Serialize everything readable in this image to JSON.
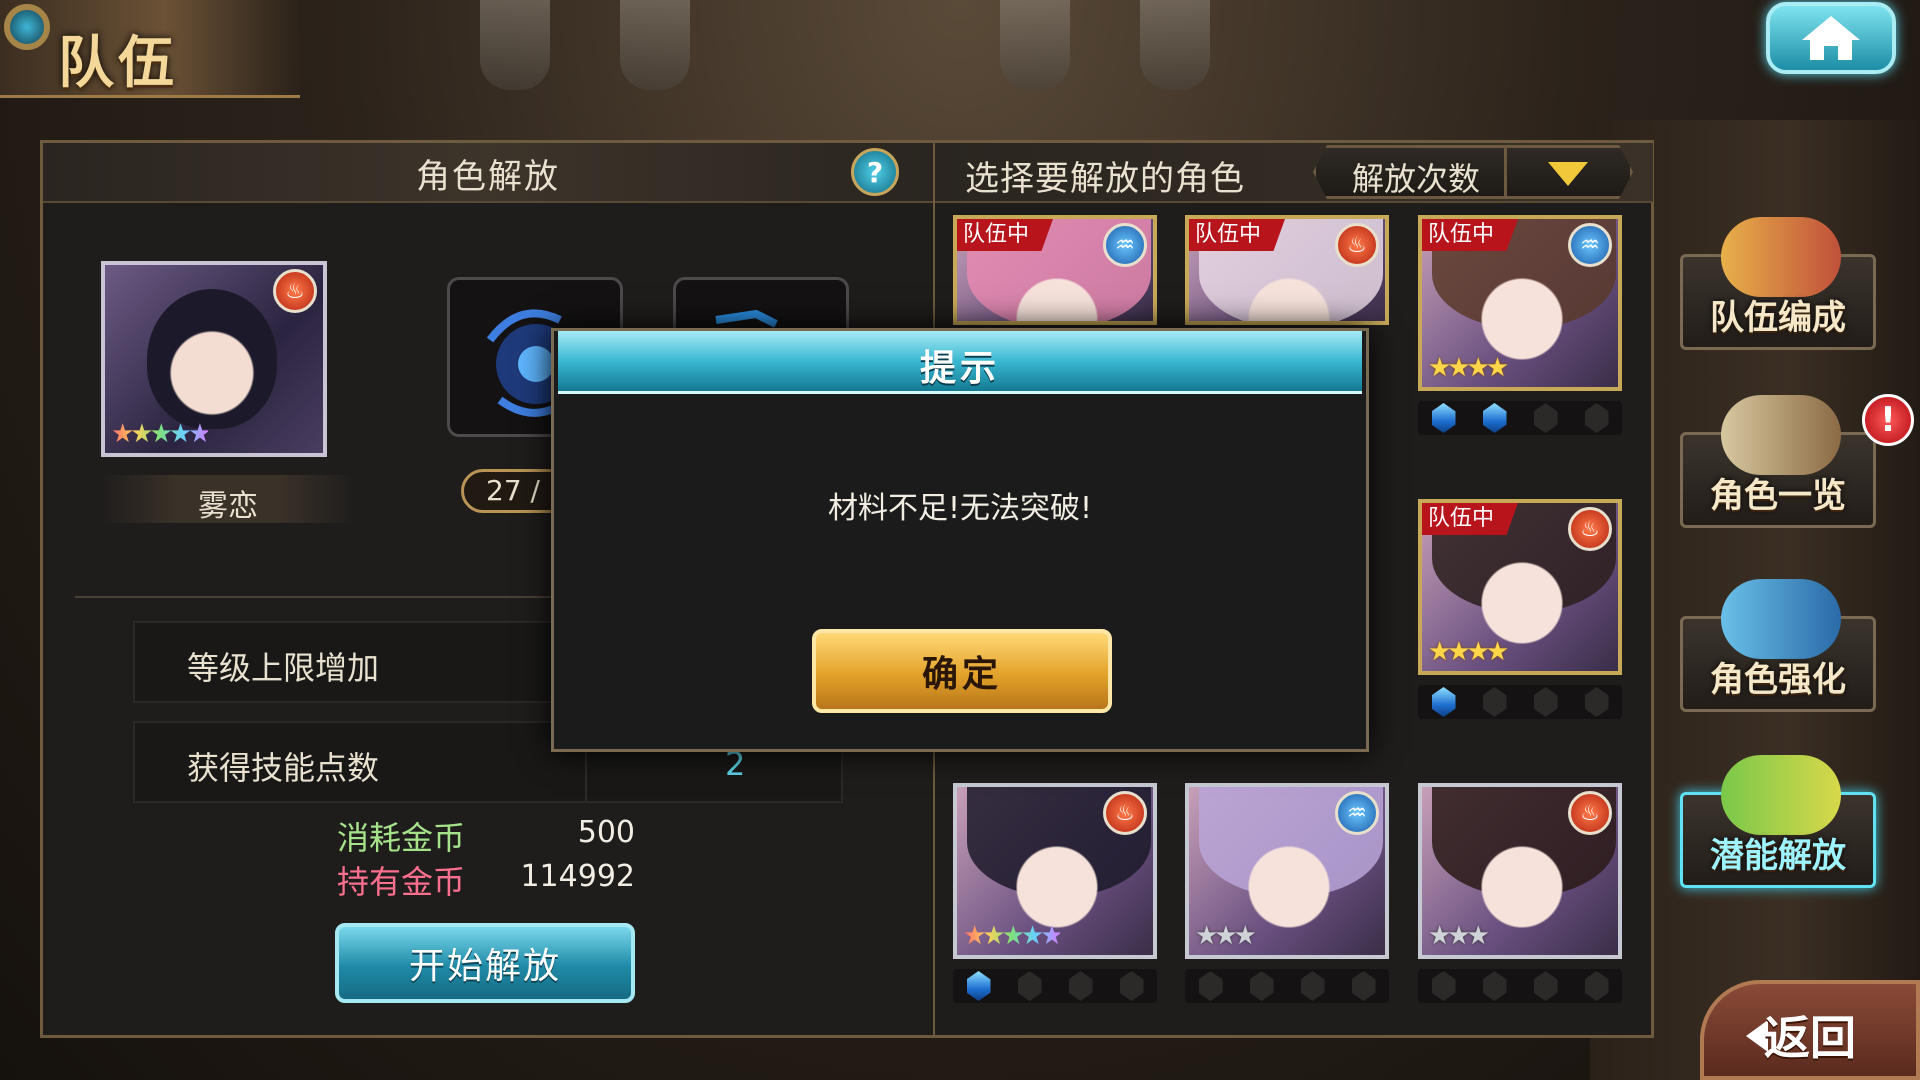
{
  "header": {
    "title": "队伍"
  },
  "left_panel": {
    "title": "角色解放",
    "help_label": "?",
    "character": {
      "name": "雾恋",
      "stars": "★★★★★"
    },
    "material_count": "27 /",
    "stats": [
      {
        "label": "等级上限增加",
        "value": ""
      },
      {
        "label": "获得技能点数",
        "value": "2"
      }
    ],
    "gold": {
      "cost_label": "消耗金币",
      "cost_value": "500",
      "have_label": "持有金币",
      "have_value": "114992"
    },
    "start_button": "开始解放"
  },
  "right_panel": {
    "title": "选择要解放的角色",
    "sort_label": "解放次数",
    "in_team_label": "队伍中",
    "cards": [
      {
        "in_team": true,
        "element": "water",
        "stars": "",
        "gems": []
      },
      {
        "in_team": true,
        "element": "fire",
        "stars": "",
        "gems": []
      },
      {
        "in_team": true,
        "element": "water",
        "stars": "★★★★",
        "gems": [
          1,
          1,
          0,
          0
        ]
      },
      {
        "in_team": true,
        "element": "fire",
        "stars": "★★★★",
        "gems": [
          1,
          0,
          0,
          0
        ]
      },
      {
        "in_team": false,
        "element": "fire",
        "stars": "★★★★★",
        "gems": [
          1,
          0,
          0,
          0
        ]
      },
      {
        "in_team": false,
        "element": "water",
        "stars": "★★★",
        "gems": [
          0,
          0,
          0,
          0
        ]
      },
      {
        "in_team": false,
        "element": "fire",
        "stars": "★★★",
        "gems": [
          0,
          0,
          0,
          0
        ]
      }
    ]
  },
  "side_menu": [
    {
      "label": "队伍编成",
      "active": false
    },
    {
      "label": "角色一览",
      "active": false,
      "alert": "!"
    },
    {
      "label": "角色强化",
      "active": false
    },
    {
      "label": "潜能解放",
      "active": true
    }
  ],
  "back_button": "返回",
  "dialog": {
    "title": "提示",
    "message": "材料不足!无法突破!",
    "ok_button": "确定"
  },
  "colors": {
    "accent_cyan": "#3bb8d2",
    "gold_button": "#e3a22a",
    "in_team_red": "#b8141c"
  }
}
